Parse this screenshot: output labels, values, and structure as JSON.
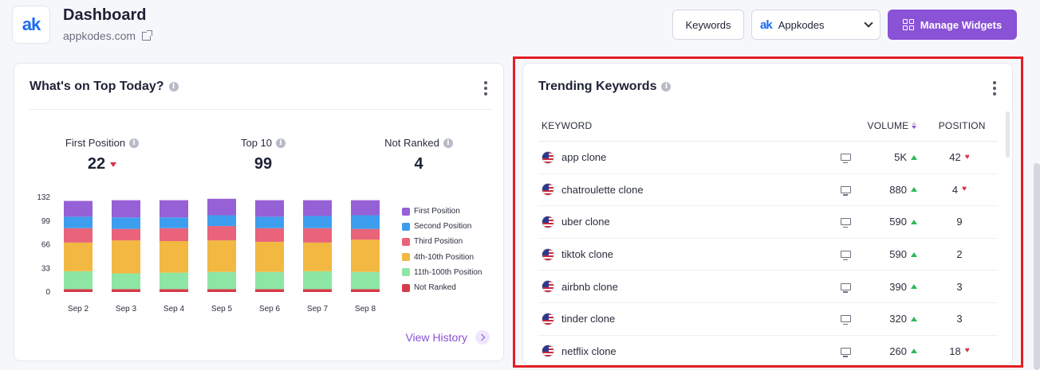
{
  "header": {
    "logo_text": "ak",
    "title": "Dashboard",
    "subtitle": "appkodes.com",
    "keywords_button": "Keywords",
    "project_select": {
      "logo_text": "ak",
      "value": "Appkodes"
    },
    "manage_widgets_button": "Manage Widgets"
  },
  "top_today": {
    "title": "What's on Top Today?",
    "stats": [
      {
        "label": "First Position",
        "value": "22",
        "trend": "down"
      },
      {
        "label": "Top 10",
        "value": "99"
      },
      {
        "label": "Not Ranked",
        "value": "4"
      }
    ],
    "view_history": "View History"
  },
  "chart_data": {
    "type": "bar",
    "stacked": true,
    "categories": [
      "Sep 2",
      "Sep 3",
      "Sep 4",
      "Sep 5",
      "Sep 6",
      "Sep 7",
      "Sep 8"
    ],
    "y_ticks": [
      "0",
      "33",
      "66",
      "99",
      "132"
    ],
    "ylim": [
      0,
      132
    ],
    "legend_position": "right",
    "series": [
      {
        "name": "Not Ranked",
        "color": "#d63b4b",
        "values": [
          4,
          4,
          4,
          4,
          4,
          4,
          4
        ]
      },
      {
        "name": "11th-100th Position",
        "color": "#8ee6a4",
        "values": [
          25,
          22,
          23,
          24,
          24,
          25,
          24
        ]
      },
      {
        "name": "4th-10th Position",
        "color": "#f2b841",
        "values": [
          40,
          46,
          44,
          44,
          42,
          40,
          45
        ]
      },
      {
        "name": "Third Position",
        "color": "#e9637a",
        "values": [
          20,
          16,
          18,
          20,
          19,
          20,
          15
        ]
      },
      {
        "name": "Second Position",
        "color": "#3d9eef",
        "values": [
          16,
          16,
          15,
          15,
          16,
          17,
          19
        ]
      },
      {
        "name": "First Position",
        "color": "#9660d6",
        "values": [
          22,
          24,
          24,
          23,
          23,
          22,
          21
        ]
      }
    ],
    "legend_order": [
      "First Position",
      "Second Position",
      "Third Position",
      "4th-10th Position",
      "11th-100th Position",
      "Not Ranked"
    ]
  },
  "trending": {
    "title": "Trending Keywords",
    "columns": {
      "keyword": "KEYWORD",
      "volume": "VOLUME",
      "position": "POSITION"
    },
    "rows": [
      {
        "keyword": "app clone",
        "volume": "5K",
        "position": "42",
        "pos_trend": "down"
      },
      {
        "keyword": "chatroulette clone",
        "volume": "880",
        "position": "4",
        "pos_trend": "down"
      },
      {
        "keyword": "uber clone",
        "volume": "590",
        "position": "9",
        "pos_trend": ""
      },
      {
        "keyword": "tiktok clone",
        "volume": "590",
        "position": "2",
        "pos_trend": ""
      },
      {
        "keyword": "airbnb clone",
        "volume": "390",
        "position": "3",
        "pos_trend": ""
      },
      {
        "keyword": "tinder clone",
        "volume": "320",
        "position": "3",
        "pos_trend": ""
      },
      {
        "keyword": "netflix clone",
        "volume": "260",
        "position": "18",
        "pos_trend": "down"
      }
    ]
  },
  "colors": {
    "accent": "#8a52d6",
    "highlight": "#e31e24",
    "up": "#2fb85d",
    "down": "#d8314a"
  }
}
